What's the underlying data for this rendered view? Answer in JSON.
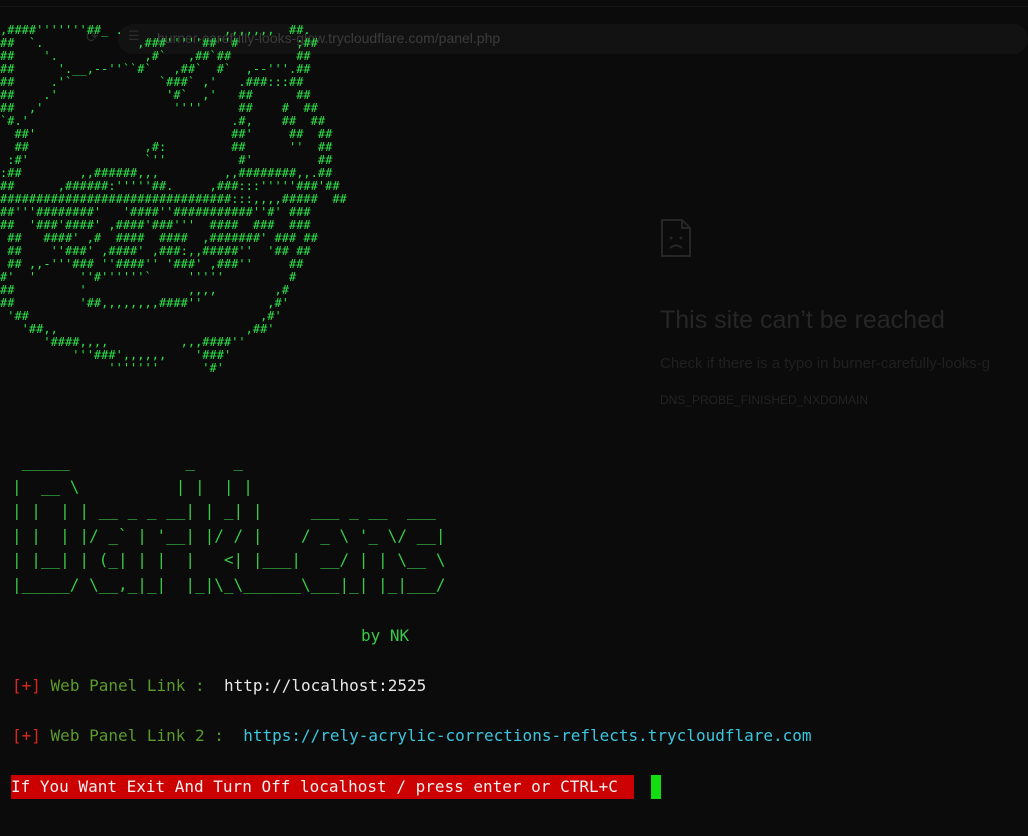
{
  "browser_ghost": {
    "url": "burner-carefully-looks-glow.trycloudflare.com/panel.php",
    "error_title": "This site can’t be reached",
    "error_body": "Check if there is a typo in burner-carefully-looks-g",
    "error_code": "DNS_PROBE_FINISHED_NXDOMAIN"
  },
  "terminal": {
    "skull_ascii": ",####'''''''##_ .              ,,,,,,,  ##.\n##  `.             ,###'''''##''#        ;##  \n##    '.            ,#`   ,##`##         ##   \n##      '.__,--''``#`   ,##`  #`  ,--'''.##   \n##     .'`            `###` ,'   .###:::##    \n##    .'               '#`  ,'   ##      ##   \n##  ,'                  ''''     ##    #  ##  \n`#.'                            .#,    ##  ## \n  ##'                           ##'     ##  ##\n  ##                ,#:         ##      ''  ##\n :#'                `''          #'         ##\n:##        ,,######,,,         ,,########,,.##\n##      ,######:'''''##.     ,###:::'''''###'##\n################################:::,,,,#####  ##\n##'''########'   '####''###########''#' ###\n##  '###'####' ,####'###'''  ####  ###  ###\n ##   ####' ,#  ####  ####  ,#######' ### ##\n ##    ''###' ,####' ,###:,,#####''  '## ##\n ## ,,-'''### ''####'' '###' ,###''     ##\n#'  '      ''#''''''`     '''''         #\n##         '              ,,,,        ,#\n##         '##,,,,,,,,####''         ,#'\n '##                                ,#'\n   '##,,                          ,##'\n      '####,,,,          ,,,####''\n          '''###',,,,,,    '###'\n               '''''''      '#'",
    "banner_ascii": " _____            _    _            \n|  __ \\          | |  | |           \n| |  | | __ _ _ __| | _| |     ___ _ __  ___ \n| |  | |/ _` | '__| |/ / |    / _ \\ '_ \\/ __|\n| |__| | (_| | |  |   <| |___|  __/ | | \\__ \\\n|_____/ \\__,_|_|  |_|\\_\\______\\___|_| |_|___/",
    "byline": "by NK",
    "lines": [
      {
        "bracket": "[+]",
        "label": "Web Panel Link :",
        "value": "http://localhost:2525"
      },
      {
        "bracket": "[+]",
        "label": "Web Panel Link 2 :",
        "value": "https://rely-acrylic-corrections-reflects.trycloudflare.com"
      }
    ],
    "exit_prompt": "If You Want Exit And Turn Off localhost / press enter or CTRL+C "
  },
  "colors": {
    "ascii_green": "#2fe34b",
    "bracket_red": "#d9281e",
    "label_green": "#5c9a2c",
    "link_cyan": "#3bc6de",
    "exit_bg": "#cc0000",
    "cursor": "#11dd11"
  }
}
